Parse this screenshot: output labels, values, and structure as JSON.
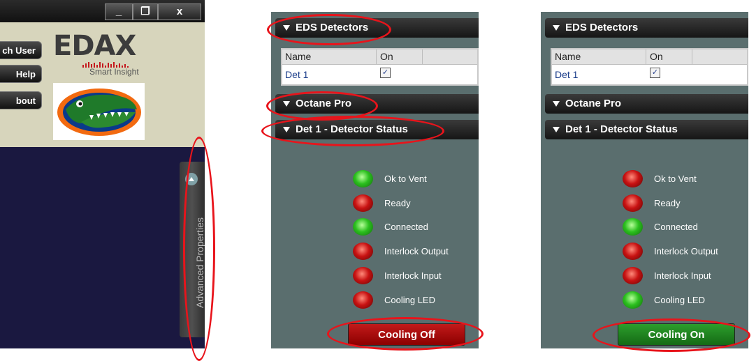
{
  "left_window": {
    "window_controls": {
      "minimize": "_",
      "maximize": "❐",
      "close": "x"
    },
    "buttons": {
      "switch_user": "ch User",
      "help": "Help",
      "about": "bout"
    },
    "logo": {
      "brand": "EDAX",
      "tagline": "Smart Insight"
    },
    "advanced_tab_label": "Advanced Properties"
  },
  "panel_off": {
    "sections": {
      "eds": "EDS Detectors",
      "octane": "Octane Pro",
      "status": "Det 1 - Detector Status"
    },
    "grid": {
      "columns": [
        "Name",
        "On"
      ],
      "rows": [
        {
          "name": "Det 1",
          "checked": "✓"
        }
      ]
    },
    "statuses": [
      {
        "label": "Ok to Vent",
        "color": "green"
      },
      {
        "label": "Ready",
        "color": "red"
      },
      {
        "label": "Connected",
        "color": "green"
      },
      {
        "label": "Interlock Output",
        "color": "red"
      },
      {
        "label": "Interlock Input",
        "color": "red"
      },
      {
        "label": "Cooling LED",
        "color": "red"
      }
    ],
    "cooling_button": "Cooling Off"
  },
  "panel_on": {
    "sections": {
      "eds": "EDS Detectors",
      "octane": "Octane Pro",
      "status": "Det 1 - Detector Status"
    },
    "grid": {
      "columns": [
        "Name",
        "On"
      ],
      "rows": [
        {
          "name": "Det 1",
          "checked": "✓"
        }
      ]
    },
    "statuses": [
      {
        "label": "Ok to Vent",
        "color": "red"
      },
      {
        "label": "Ready",
        "color": "red"
      },
      {
        "label": "Connected",
        "color": "green"
      },
      {
        "label": "Interlock Output",
        "color": "red"
      },
      {
        "label": "Interlock Input",
        "color": "red"
      },
      {
        "label": "Cooling LED",
        "color": "green"
      }
    ],
    "cooling_button": "Cooling On"
  },
  "colors": {
    "highlight": "#e8141b",
    "led_green": "#2bbf1e",
    "led_red": "#c81212",
    "panel_bg": "#5a6e6e"
  }
}
